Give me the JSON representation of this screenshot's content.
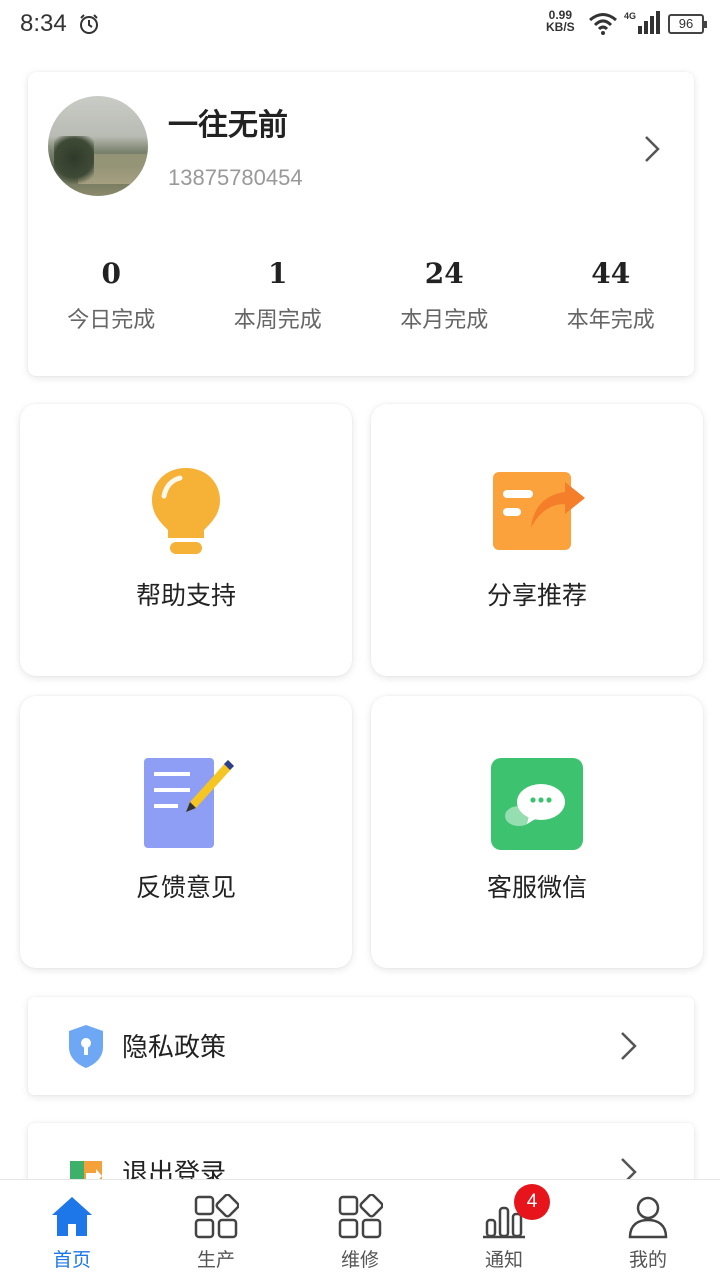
{
  "status_bar": {
    "time": "8:34",
    "net_speed_value": "0.99",
    "net_speed_unit": "KB/S",
    "network_type": "4G",
    "battery": "96",
    "icons": [
      "alarm-icon",
      "wifi-icon",
      "signal-icon",
      "battery-icon"
    ]
  },
  "profile": {
    "name": "一往无前",
    "phone": "13875780454",
    "stats": [
      {
        "value": "0",
        "label": "今日完成"
      },
      {
        "value": "1",
        "label": "本周完成"
      },
      {
        "value": "24",
        "label": "本月完成"
      },
      {
        "value": "44",
        "label": "本年完成"
      }
    ]
  },
  "tiles": [
    {
      "label": "帮助支持",
      "icon": "lightbulb-icon",
      "color": "#F5B236"
    },
    {
      "label": "分享推荐",
      "icon": "share-icon",
      "color": "#FBA23C"
    },
    {
      "label": "反馈意见",
      "icon": "feedback-icon",
      "color": "#8E9EF5"
    },
    {
      "label": "客服微信",
      "icon": "wechat-icon",
      "color": "#3DC36F"
    }
  ],
  "list": [
    {
      "label": "隐私政策",
      "icon": "shield-icon"
    },
    {
      "label": "退出登录",
      "icon": "logout-icon"
    }
  ],
  "bottom_nav": {
    "items": [
      {
        "label": "首页",
        "icon": "home-icon",
        "active": true
      },
      {
        "label": "生产",
        "icon": "grid-icon"
      },
      {
        "label": "维修",
        "icon": "grid-icon"
      },
      {
        "label": "通知",
        "icon": "bar-chart-icon",
        "badge": "4"
      },
      {
        "label": "我的",
        "icon": "person-icon"
      }
    ],
    "active_color": "#1E77E8",
    "badge_color": "#E8141B"
  }
}
